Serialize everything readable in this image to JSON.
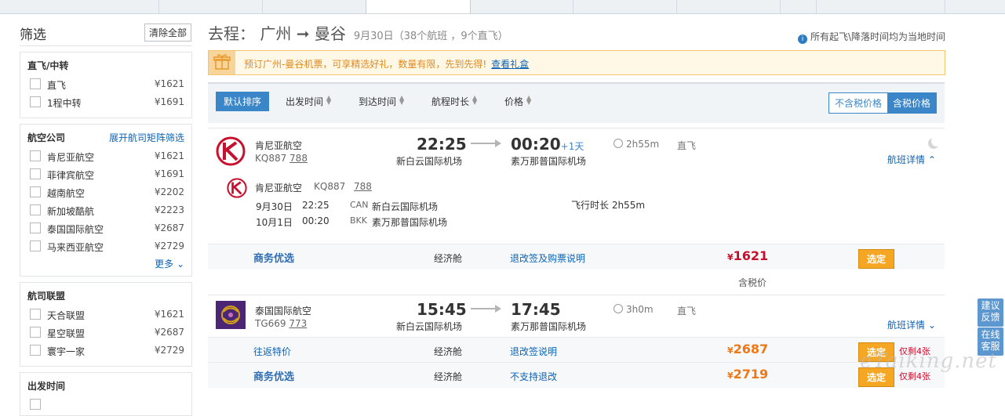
{
  "filter": {
    "title": "筛选",
    "clear_all": "清除全部",
    "stops": {
      "title": "直飞/中转",
      "items": [
        {
          "label": "直飞",
          "price": "¥1621"
        },
        {
          "label": "1程中转",
          "price": "¥1691"
        }
      ]
    },
    "airlines": {
      "title": "航空公司",
      "link": "展开航司矩阵筛选",
      "items": [
        {
          "label": "肯尼亚航空",
          "price": "¥1621"
        },
        {
          "label": "菲律宾航空",
          "price": "¥1691"
        },
        {
          "label": "越南航空",
          "price": "¥2202"
        },
        {
          "label": "新加坡酷航",
          "price": "¥2223"
        },
        {
          "label": "泰国国际航空",
          "price": "¥2687"
        },
        {
          "label": "马来西亚航空",
          "price": "¥2729"
        }
      ],
      "more": "更多"
    },
    "alliance": {
      "title": "航司联盟",
      "items": [
        {
          "label": "天合联盟",
          "price": "¥1621"
        },
        {
          "label": "星空联盟",
          "price": "¥2687"
        },
        {
          "label": "寰宇一家",
          "price": "¥2729"
        }
      ]
    },
    "depart_time": {
      "title": "出发时间"
    }
  },
  "header": {
    "route": "去程： 广州 ➞ 曼谷",
    "summary": "9月30日（38个航班 ，9个直飞）",
    "time_note": "所有起飞\\降落时间均为当地时间"
  },
  "promo": {
    "text": "预订广州-曼谷机票，可享精选好礼，数量有限，先到先得!",
    "link": "查看礼盒"
  },
  "sort": {
    "default": "默认排序",
    "items": [
      "出发时间",
      "到达时间",
      "航程时长",
      "价格"
    ],
    "no_tax": "不含税价格",
    "with_tax": "含税价格"
  },
  "flights": [
    {
      "airline": "肯尼亚航空",
      "flight_no": "KQ887",
      "aircraft": "788",
      "dep_time": "22:25",
      "arr_time": "00:20",
      "plus_day": "+1天",
      "dep_airport": "新白云国际机场",
      "arr_airport": "素万那普国际机场",
      "duration": "2h55m",
      "type": "直飞",
      "detail_label": "航班详情",
      "detail": {
        "airline": "肯尼亚航空",
        "flight_no": "KQ887",
        "aircraft": "788",
        "dep_date": "9月30日",
        "dep_time": "22:25",
        "dep_code": "CAN",
        "dep_airport": "新白云国际机场",
        "arr_date": "10月1日",
        "arr_time": "00:20",
        "arr_code": "BKK",
        "arr_airport": "素万那普国际机场",
        "flight_time": "飞行时长 2h55m"
      },
      "fares": [
        {
          "product": "商务优选",
          "cabin": "经济舱",
          "rule": "退改签及购票说明",
          "price": "1621",
          "select": "选定"
        }
      ],
      "tax_note": "含税价"
    },
    {
      "airline": "泰国国际航空",
      "flight_no": "TG669",
      "aircraft": "773",
      "dep_time": "15:45",
      "arr_time": "17:45",
      "dep_airport": "新白云国际机场",
      "arr_airport": "素万那普国际机场",
      "duration": "3h0m",
      "type": "直飞",
      "detail_label": "航班详情",
      "fares": [
        {
          "product": "往返特价",
          "cabin": "经济舱",
          "rule": "退改签说明",
          "price": "2687",
          "select": "选定",
          "left": "仅剩4张"
        },
        {
          "product": "商务优选",
          "cabin": "经济舱",
          "rule": "不支持退改",
          "price": "2719",
          "select": "选定",
          "left": "仅剩4张"
        }
      ]
    }
  ],
  "side_buttons": {
    "feedback": "建议反馈",
    "service": "在线客服"
  },
  "watermark": "eTaiking.net",
  "colors": {
    "accent": "#3a86c8",
    "price_red": "#c8102e",
    "price_orange": "#f07814",
    "select_btn": "#f5a623"
  }
}
